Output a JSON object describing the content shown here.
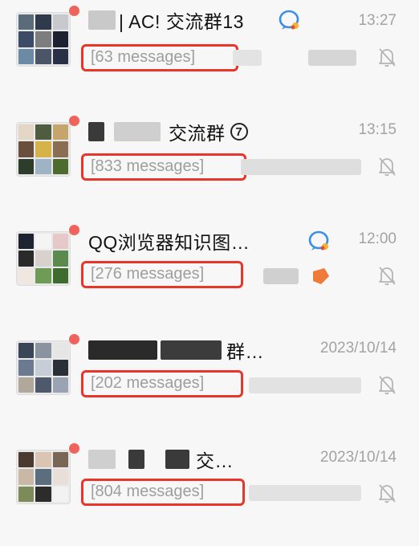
{
  "chats": [
    {
      "title_visible": "| AC! 交流群13",
      "time": "13:27",
      "messages": "[63 messages]",
      "has_qq_badge": true,
      "mute": true
    },
    {
      "title_visible": "交流群",
      "time": "13:15",
      "messages": "[833 messages]",
      "badge_number": "7",
      "mute": true
    },
    {
      "title_visible": "QQ浏览器知识图…",
      "time": "12:00",
      "messages": "[276 messages]",
      "has_qq_badge": true,
      "mute": true
    },
    {
      "title_visible": "群…",
      "time": "2023/10/14",
      "messages": "[202 messages]",
      "mute": true
    },
    {
      "title_visible": "交…",
      "time": "2023/10/14",
      "messages": "[804 messages]",
      "mute": true
    }
  ],
  "colors": {
    "unread": "#f0625c",
    "highlight_box": "#e8372a",
    "time": "#a3a3a3",
    "preview": "#9e9e9e"
  },
  "icons": {
    "mute": "bell-slash-icon",
    "qq": "qq-logo-icon"
  }
}
